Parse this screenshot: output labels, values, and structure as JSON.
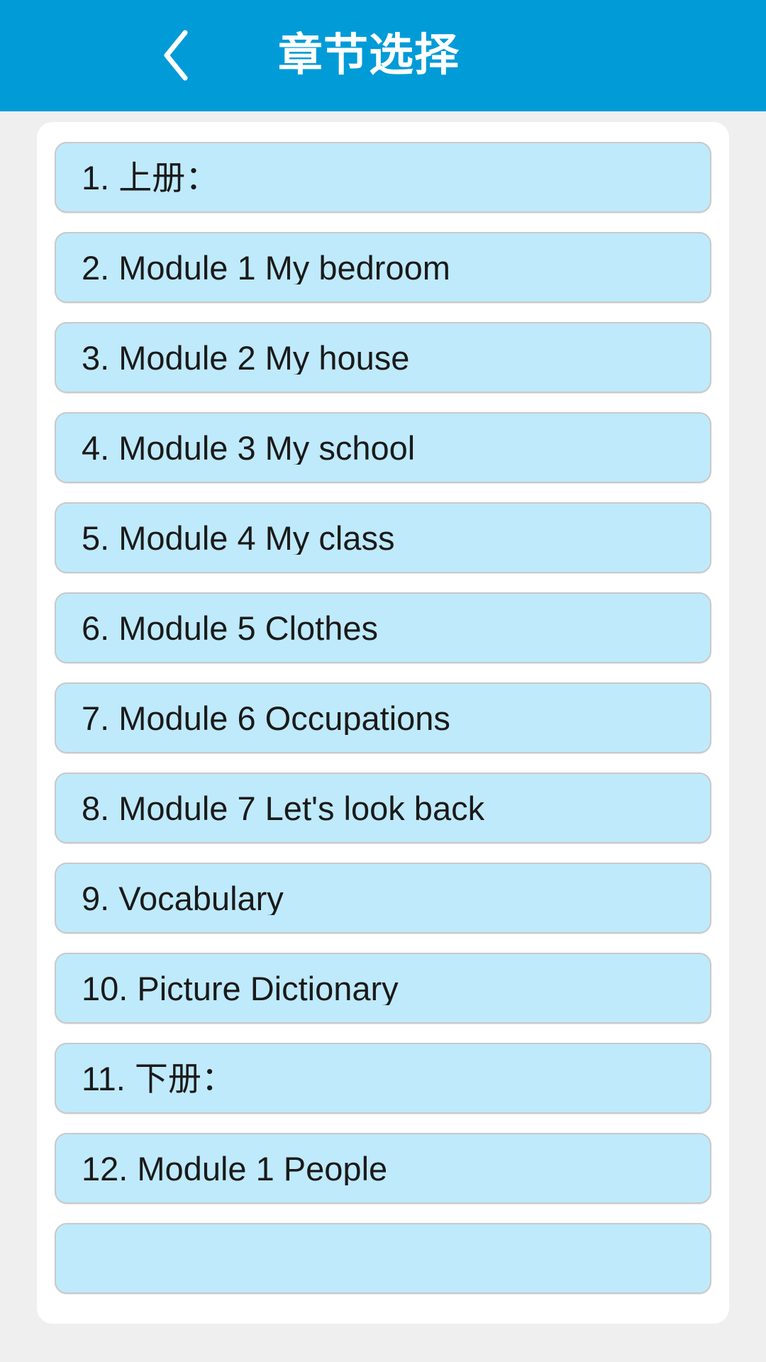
{
  "app": {
    "title": "章节选择",
    "header_background": "#019BD8",
    "header_text_color": "#FFFFFF",
    "page_background": "#EFEFEF",
    "card_background": "#FFFFFF",
    "item_background": "#BFEAFB",
    "item_border_color": "#C9C9C9",
    "item_text_color": "#1A1A1A"
  },
  "navigation": {
    "back_icon": "chevron-left-icon"
  },
  "chapter_list": {
    "items": [
      {
        "label": "1. 上册："
      },
      {
        "label": "2. Module 1 My bedroom"
      },
      {
        "label": "3. Module 2 My house"
      },
      {
        "label": "4. Module 3 My school"
      },
      {
        "label": "5. Module 4 My class"
      },
      {
        "label": "6. Module 5 Clothes"
      },
      {
        "label": "7. Module 6 Occupations"
      },
      {
        "label": "8. Module 7 Let's look back"
      },
      {
        "label": "9. Vocabulary"
      },
      {
        "label": "10. Picture Dictionary"
      },
      {
        "label": "11. 下册："
      },
      {
        "label": "12. Module 1 People"
      },
      {
        "label": ""
      }
    ]
  }
}
